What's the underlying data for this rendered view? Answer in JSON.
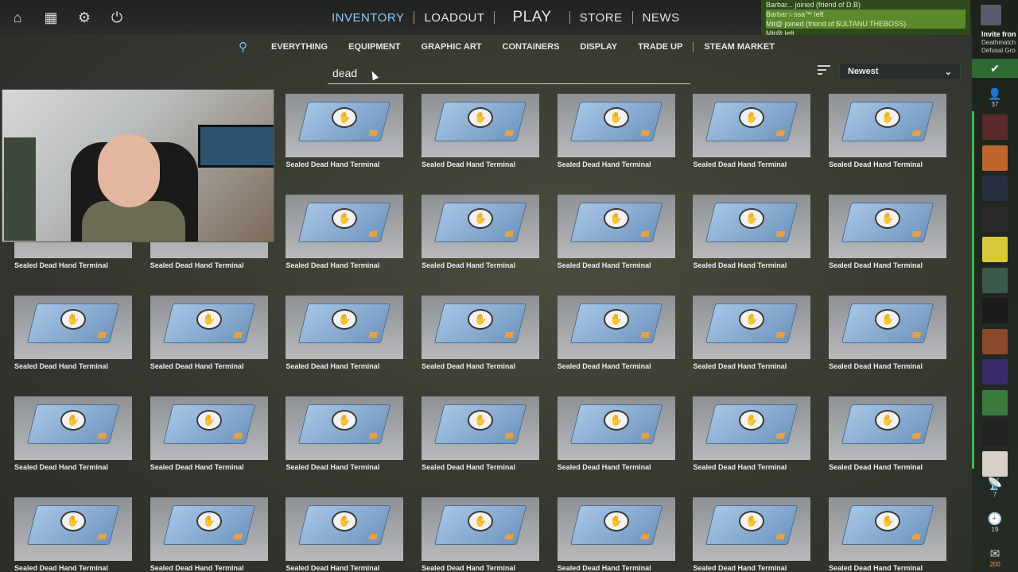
{
  "topnav": {
    "items": [
      {
        "label": "INVENTORY",
        "active": true
      },
      {
        "label": "LOADOUT"
      },
      {
        "label": "PLAY"
      },
      {
        "label": "STORE"
      },
      {
        "label": "NEWS"
      }
    ],
    "icons": [
      "home-icon",
      "tv-icon",
      "gear-icon",
      "power-icon"
    ]
  },
  "chatfeed": [
    "Barbar... joined (friend of D.B)",
    "Barbar☆ssa™ left",
    "Mit@ joined (friend of $ULTANU THEBOSS)",
    "Mit@ left"
  ],
  "subnav": {
    "items": [
      "EVERYTHING",
      "EQUIPMENT",
      "GRAPHIC ART",
      "CONTAINERS",
      "DISPLAY",
      "TRADE UP",
      "STEAM MARKET"
    ]
  },
  "search": {
    "value": "dead"
  },
  "sort": {
    "selected": "Newest"
  },
  "items": {
    "label": "Sealed Dead Hand Terminal",
    "count": 35
  },
  "friends": {
    "invite_title": "Invite fron",
    "invite_line2": "Deathmatch",
    "invite_line3": "Defusal Gro",
    "online_count": "37",
    "tools": [
      {
        "icon": "broadcast-icon",
        "count": "7"
      },
      {
        "icon": "history-icon",
        "count": "19"
      },
      {
        "icon": "mail-icon",
        "count": "200"
      }
    ],
    "avatar_colors": [
      "#5a2a2a",
      "#c0652e",
      "#2a3040",
      "#2a2a2a",
      "#d8c93a",
      "#3a5a4a",
      "#1a1a1a",
      "#8a4a2a",
      "#3a2a6a",
      "#3a7a3a",
      "#222222",
      "#d8d0c8"
    ]
  },
  "colors": {
    "accent": "#8fc8ff",
    "online": "#43b548",
    "chat_bg": "#2f4a1e"
  }
}
